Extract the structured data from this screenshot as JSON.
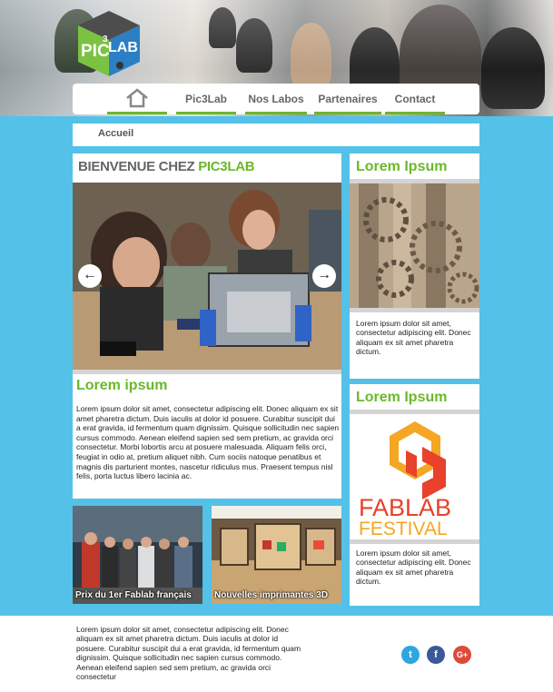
{
  "header": {
    "logo": {
      "top_text": "PIC",
      "main_text": "LAB",
      "digit": "3"
    }
  },
  "nav": {
    "items": [
      {
        "label": ""
      },
      {
        "label": "Pic3Lab"
      },
      {
        "label": "Nos Labos"
      },
      {
        "label": "Partenaires"
      },
      {
        "label": "Contact"
      }
    ],
    "home_icon": "home-icon"
  },
  "breadcrumb": {
    "label": "Accueil"
  },
  "main": {
    "welcome_prefix": "BIENVENUE CHEZ ",
    "welcome_accent": "PIC3LAB",
    "slider": {
      "prev_icon": "←",
      "next_icon": "→"
    },
    "heading": "Lorem ipsum",
    "text": "Lorem ipsum dolor sit amet, consectetur adipiscing elit. Donec aliquam ex sit amet pharetra dictum. Duis iaculis at dolor id posuere. Curabitur suscipit dui a erat gravida, id fermentum quam dignissim. Quisque sollicitudin nec sapien cursus commodo. Aenean eleifend sapien sed sem pretium, ac gravida orci consectetur. Morbi lobortis arcu at posuere malesuada. Aliquam felis orci, feugiat in odio at, pretium aliquet nibh. Cum sociis natoque penatibus et magnis dis parturient montes, nascetur ridiculus mus. Praesent tempus nisl felis, porta luctus libero lacinia ac."
  },
  "sidebar": {
    "cards": [
      {
        "title": "Lorem Ipsum",
        "text": "Lorem ipsum dolor sit amet, consectetur adipiscing elit. Donec aliquam ex sit amet pharetra dictum."
      },
      {
        "title": "Lorem Ipsum",
        "text": "Lorem ipsum dolor sit amet, consectetur adipiscing elit. Donec aliquam ex sit amet pharetra dictum.",
        "logo": {
          "line1": "FABLAB",
          "line2": "FESTIVAL"
        }
      }
    ]
  },
  "thumbnails": [
    {
      "caption": "Prix du 1er Fablab français"
    },
    {
      "caption": "Nouvelles imprimantes 3D"
    }
  ],
  "footer": {
    "text": "Lorem ipsum dolor sit amet, consectetur adipiscing elit. Donec aliquam ex sit amet pharetra dictum. Duis iaculis at dolor id posuere. Curabitur suscipit dui a erat gravida, id fermentum quam dignissim. Quisque sollicitudin nec sapien cursus commodo. Aenean eleifend sapien sed sem pretium, ac gravida orci consectetur",
    "social": [
      {
        "icon": "twitter-icon",
        "glyph": "t",
        "color": "#2ca7e0"
      },
      {
        "icon": "facebook-icon",
        "glyph": "f",
        "color": "#3b5998"
      },
      {
        "icon": "google-plus-icon",
        "glyph": "G+",
        "color": "#dd4b39"
      }
    ]
  },
  "colors": {
    "accent": "#6bb82a",
    "background": "#54c1e8",
    "logo_blue": "#2b7fc4"
  }
}
